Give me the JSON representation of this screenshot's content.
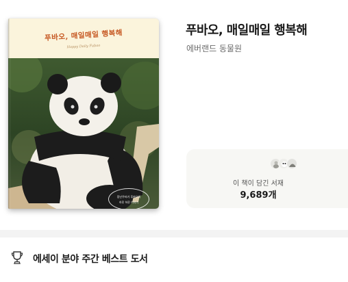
{
  "book": {
    "title": "푸바오, 매일매일 행복해",
    "author": "에버랜드 동물원",
    "cover": {
      "title": "푸바오, 매일매일 행복해",
      "subtitle": "Happy Daily Fubao",
      "badge_line1": "장난꾸러기 푸바오의",
      "badge_line2": "하루 하루 이야기"
    }
  },
  "shelf": {
    "label": "이 책이 담긴 서재",
    "count": "9,689개"
  },
  "bestseller": {
    "label": "에세이 분야 주간 베스트 도서",
    "icon": "trophy-icon"
  },
  "colors": {
    "cover_cream": "#fbf4dc",
    "cover_title": "#c5551f",
    "card_bg": "#f7f7f4",
    "divider": "#f3f3f3"
  }
}
